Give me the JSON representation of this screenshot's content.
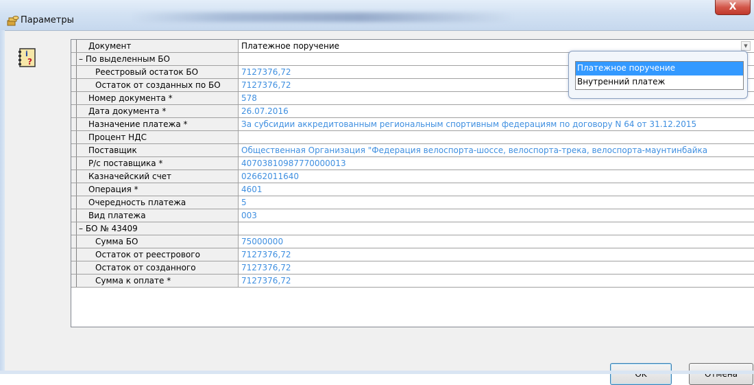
{
  "window": {
    "title": "Параметры",
    "close_glyph": "X",
    "accent": "#3399ff",
    "value_color": "#3f8fe0"
  },
  "grid": {
    "rows": [
      {
        "kind": "field",
        "name": "Документ",
        "value": "Платежное поручение"
      },
      {
        "kind": "group",
        "name": "– По выделенным БО",
        "value": ""
      },
      {
        "kind": "sub",
        "name": "Реестровый остаток БО",
        "value": "7127376,72"
      },
      {
        "kind": "sub",
        "name": "Остаток от созданных по БО",
        "value": "7127376,72"
      },
      {
        "kind": "field",
        "name": "Номер документа *",
        "value": "578"
      },
      {
        "kind": "field",
        "name": "Дата документа *",
        "value": "26.07.2016"
      },
      {
        "kind": "field",
        "name": "Назначение платежа *",
        "value": "За субсидии  аккредитованным региональным спортивным федерациям по договору N 64 от 31.12.2015"
      },
      {
        "kind": "field",
        "name": "Процент НДС",
        "value": ""
      },
      {
        "kind": "field",
        "name": "Поставщик",
        "value": "Общественная  Организация \"Федерация велоспорта-шоссе, велоспорта-трека, велоспорта-маунтинбайка"
      },
      {
        "kind": "field",
        "name": "Р/с поставщика *",
        "value": "40703810987770000013"
      },
      {
        "kind": "field",
        "name": "Казначейский счет",
        "value": "02662011640"
      },
      {
        "kind": "field",
        "name": "Операция *",
        "value": "4601"
      },
      {
        "kind": "field",
        "name": "Очередность платежа",
        "value": "5"
      },
      {
        "kind": "field",
        "name": "Вид платежа",
        "value": "003"
      },
      {
        "kind": "group",
        "name": "– БО № 43409",
        "value": ""
      },
      {
        "kind": "sub",
        "name": "Сумма БО",
        "value": "75000000"
      },
      {
        "kind": "sub",
        "name": "Остаток от реестрового",
        "value": "7127376,72"
      },
      {
        "kind": "sub",
        "name": "Остаток от созданного",
        "value": "7127376,72"
      },
      {
        "kind": "sub",
        "name": "Сумма к оплате *",
        "value": "7127376,72"
      }
    ]
  },
  "dropdown": {
    "options": [
      "Платежное поручение",
      "Внутренний платеж"
    ],
    "selected_index": 0
  },
  "buttons": {
    "ok": "OK",
    "cancel": "Отмена"
  }
}
